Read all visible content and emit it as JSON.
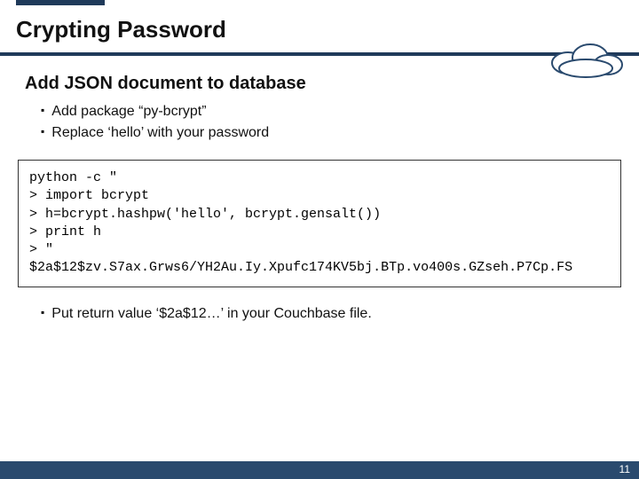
{
  "slide": {
    "title": "Crypting Password",
    "subtitle": "Add JSON document to database",
    "bullets": [
      "Add package “py-bcrypt”",
      "Replace ‘hello’ with your password"
    ],
    "code_lines": [
      "python -c \"",
      "> import bcrypt",
      "> h=bcrypt.hashpw('hello', bcrypt.gensalt())",
      "> print h",
      "> \"",
      "$2a$12$zv.S7ax.Grws6/YH2Au.Iy.Xpufc174KV5bj.BTp.vo400s.GZseh.P7Cp.FS"
    ],
    "post_bullet": "Put return value ‘$2a$12…’ in your Couchbase file.",
    "page_number": "11"
  }
}
